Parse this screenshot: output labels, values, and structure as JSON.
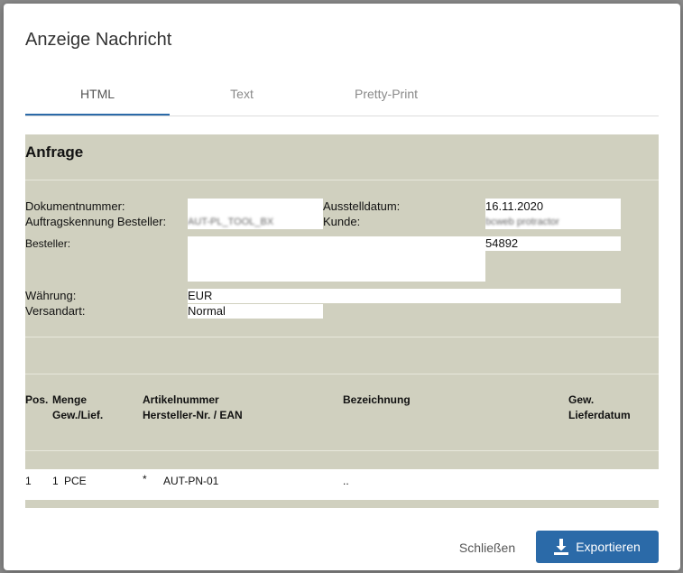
{
  "dialog": {
    "title": "Anzeige Nachricht",
    "tabs": [
      {
        "label": "HTML",
        "active": true
      },
      {
        "label": "Text",
        "active": false
      },
      {
        "label": "Pretty-Print",
        "active": false
      }
    ],
    "close_label": "Schließen",
    "export_label": "Exportieren",
    "accent_color": "#2b6aa8"
  },
  "document": {
    "heading": "Anfrage",
    "labels": {
      "dokumentnummer": "Dokumentnummer:",
      "auftragskennung": "Auftragskennung Besteller:",
      "ausstelldatum": "Ausstelldatum:",
      "kunde": "Kunde:",
      "besteller": "Besteller:",
      "waehrung": "Währung:",
      "versandart": "Versandart:"
    },
    "values": {
      "dokumentnummer": "",
      "auftragskennung": "AUT-PL_TOOL_BX",
      "ausstelldatum": "16.11.2020",
      "kunde": "bcweb protractor",
      "besteller": "",
      "besteller_nr": "54892",
      "waehrung": "EUR",
      "versandart": "Normal"
    },
    "table": {
      "headers": {
        "pos": "Pos.",
        "menge": "Menge",
        "gew_lief": "Gew./Lief.",
        "artikelnummer": "Artikelnummer",
        "hersteller": "Hersteller-Nr. / EAN",
        "bezeichnung": "Bezeichnung",
        "gew": "Gew.",
        "lieferdatum": "Lieferdatum"
      },
      "rows": [
        {
          "pos": "1",
          "menge": "1",
          "unit": "PCE",
          "mark": "*",
          "artikelnummer": "AUT-PN-01",
          "bezeichnung": ".."
        }
      ]
    }
  }
}
